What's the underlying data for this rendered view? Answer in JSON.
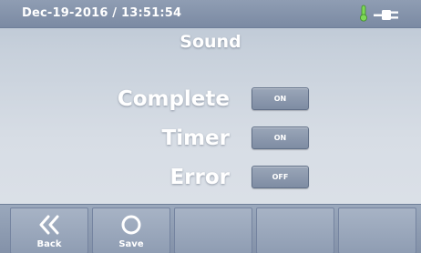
{
  "status_bar": {
    "datetime": "Dec-19-2016 / 13:51:54",
    "indicators": [
      "thermometer-icon",
      "power-plug-icon"
    ],
    "thermometer_color": "#7ed957"
  },
  "page": {
    "title": "Sound"
  },
  "settings": [
    {
      "label": "Complete",
      "state": "ON"
    },
    {
      "label": "Timer",
      "state": "ON"
    },
    {
      "label": "Error",
      "state": "OFF"
    }
  ],
  "bottom_bar": {
    "buttons": [
      {
        "label": "Back",
        "icon": "double-chevron-left-icon"
      },
      {
        "label": "Save",
        "icon": "circle-icon"
      },
      {
        "label": "",
        "icon": ""
      },
      {
        "label": "",
        "icon": ""
      },
      {
        "label": "",
        "icon": ""
      }
    ]
  }
}
